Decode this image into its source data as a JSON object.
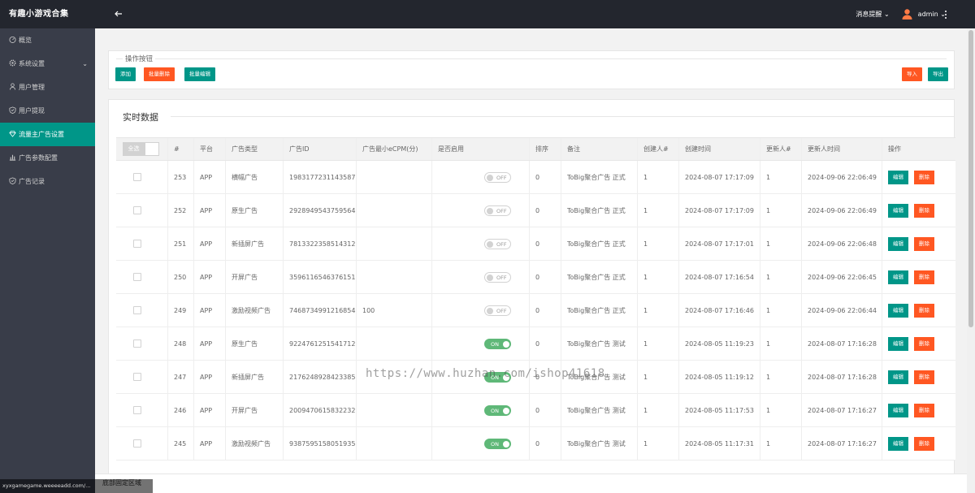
{
  "app": {
    "title": "有趣小游戏合集"
  },
  "sidebar": {
    "items": [
      {
        "label": "概览",
        "icon": "dashboard-icon"
      },
      {
        "label": "系统设置",
        "icon": "gear-icon",
        "has_caret": true
      },
      {
        "label": "用户管理",
        "icon": "user-icon"
      },
      {
        "label": "用户提现",
        "icon": "shield-icon"
      },
      {
        "label": "流量主广告设置",
        "icon": "diamond-icon",
        "active": true
      },
      {
        "label": "广告参数配置",
        "icon": "chart-icon"
      },
      {
        "label": "广告记录",
        "icon": "check-shield-icon"
      }
    ]
  },
  "topbar": {
    "message_label": "消息提醒",
    "user_label": "admin"
  },
  "actions_card": {
    "legend": "操作按钮",
    "add_label": "添加",
    "batch_delete_label": "批量删除",
    "batch_edit_label": "批量编辑",
    "import_label": "导入",
    "export_label": "导出"
  },
  "table_card": {
    "title": "实时数据",
    "select_all_label": "全选",
    "columns": [
      "#",
      "平台",
      "广告类型",
      "广告ID",
      "广告最小eCPM(分)",
      "是否启用",
      "排序",
      "备注",
      "创建人#",
      "创建时间",
      "更新人#",
      "更新人时间",
      "操作"
    ],
    "edit_label": "编辑",
    "delete_label": "删除",
    "rows": [
      {
        "id": "253",
        "platform": "APP",
        "type": "横幅广告",
        "ad_id": "1983177231143587",
        "ecpm": "",
        "enabled": false,
        "switch": "OFF",
        "sort": "0",
        "note": "ToBig聚合广告 正式",
        "creator": "1",
        "created": "2024-08-07 17:17:09",
        "updater": "1",
        "updated": "2024-09-06 22:06:49"
      },
      {
        "id": "252",
        "platform": "APP",
        "type": "原生广告",
        "ad_id": "2928949543759564",
        "ecpm": "",
        "enabled": false,
        "switch": "OFF",
        "sort": "0",
        "note": "ToBig聚合广告 正式",
        "creator": "1",
        "created": "2024-08-07 17:17:09",
        "updater": "1",
        "updated": "2024-09-06 22:06:49"
      },
      {
        "id": "251",
        "platform": "APP",
        "type": "新插屏广告",
        "ad_id": "7813322358514312",
        "ecpm": "",
        "enabled": false,
        "switch": "OFF",
        "sort": "0",
        "note": "ToBig聚合广告 正式",
        "creator": "1",
        "created": "2024-08-07 17:17:01",
        "updater": "1",
        "updated": "2024-09-06 22:06:48"
      },
      {
        "id": "250",
        "platform": "APP",
        "type": "开屏广告",
        "ad_id": "3596116546376151",
        "ecpm": "",
        "enabled": false,
        "switch": "OFF",
        "sort": "0",
        "note": "ToBig聚合广告 正式",
        "creator": "1",
        "created": "2024-08-07 17:16:54",
        "updater": "1",
        "updated": "2024-09-06 22:06:45"
      },
      {
        "id": "249",
        "platform": "APP",
        "type": "激励视频广告",
        "ad_id": "7468734991216854",
        "ecpm": "100",
        "enabled": false,
        "switch": "OFF",
        "sort": "0",
        "note": "ToBig聚合广告 正式",
        "creator": "1",
        "created": "2024-08-07 17:16:46",
        "updater": "1",
        "updated": "2024-09-06 22:06:44"
      },
      {
        "id": "248",
        "platform": "APP",
        "type": "原生广告",
        "ad_id": "9224761251541712",
        "ecpm": "",
        "enabled": true,
        "switch": "ON",
        "sort": "0",
        "note": "ToBig聚合广告 测试",
        "creator": "1",
        "created": "2024-08-05 11:19:23",
        "updater": "1",
        "updated": "2024-08-07 17:16:28"
      },
      {
        "id": "247",
        "platform": "APP",
        "type": "新插屏广告",
        "ad_id": "2176248928423385",
        "ecpm": "",
        "enabled": true,
        "switch": "ON",
        "sort": "0",
        "note": "ToBig聚合广告 测试",
        "creator": "1",
        "created": "2024-08-05 11:19:12",
        "updater": "1",
        "updated": "2024-08-07 17:16:28"
      },
      {
        "id": "246",
        "platform": "APP",
        "type": "开屏广告",
        "ad_id": "2009470615832232",
        "ecpm": "",
        "enabled": true,
        "switch": "ON",
        "sort": "0",
        "note": "ToBig聚合广告 测试",
        "creator": "1",
        "created": "2024-08-05 11:17:53",
        "updater": "1",
        "updated": "2024-08-07 17:16:27"
      },
      {
        "id": "245",
        "platform": "APP",
        "type": "激励视频广告",
        "ad_id": "9387595158051935",
        "ecpm": "",
        "enabled": true,
        "switch": "ON",
        "sort": "0",
        "note": "ToBig聚合广告 测试",
        "creator": "1",
        "created": "2024-08-05 11:17:31",
        "updater": "1",
        "updated": "2024-08-07 17:16:27"
      }
    ]
  },
  "footer": {
    "label": "底部固定区域"
  },
  "watermark": "https://www.huzhan.com/ishop41618",
  "statusbar": {
    "url": "xyxgamegame.weeeeadd.com/..."
  },
  "colors": {
    "teal": "#009688",
    "orange": "#ff5722",
    "switch_on": "#5fb878",
    "sidebar": "#393d49",
    "topbar": "#23262e"
  }
}
